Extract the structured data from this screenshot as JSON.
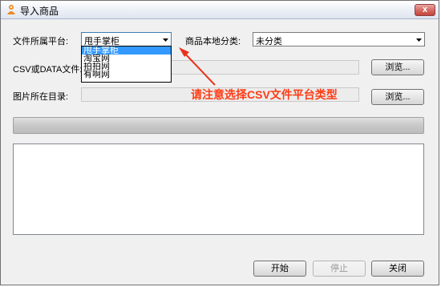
{
  "window": {
    "title": "导入商品",
    "close_label": "x"
  },
  "platform": {
    "label": "文件所属平台:",
    "selected": "甩手掌柜",
    "options": [
      "甩手掌柜",
      "淘宝网",
      "拍拍网",
      "有啊网"
    ]
  },
  "category": {
    "label": "商品本地分类:",
    "selected": "未分类"
  },
  "csv": {
    "label": "CSV或DATA文件:",
    "browse_label": "浏览..."
  },
  "images": {
    "label": "图片所在目录:",
    "browse_label": "浏览..."
  },
  "annotation": {
    "text": "请注意选择CSV文件平台类型",
    "color": "#ff3b14"
  },
  "buttons": {
    "start": "开始",
    "stop": "停止",
    "close": "关闭"
  }
}
